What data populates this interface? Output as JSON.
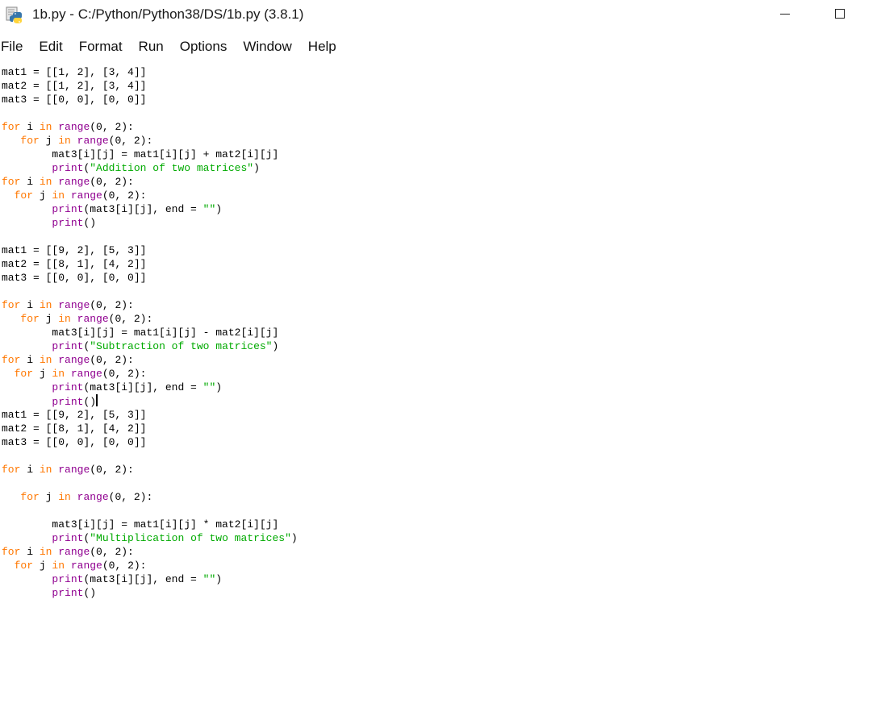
{
  "window": {
    "title": "1b.py - C:/Python/Python38/DS/1b.py (3.8.1)",
    "icon": "python-idle-icon",
    "controls": [
      "minimize-icon",
      "maximize-icon"
    ]
  },
  "menu": {
    "items": [
      "File",
      "Edit",
      "Format",
      "Run",
      "Options",
      "Window",
      "Help"
    ]
  },
  "colors": {
    "keyword": "#ff7700",
    "builtin": "#900090",
    "string": "#00aa00",
    "default": "#000000"
  },
  "editor": {
    "caret_line": 24,
    "lines": [
      [
        [
          "",
          "mat1 = [[1, 2], [3, 4]]"
        ]
      ],
      [
        [
          "",
          "mat2 = [[1, 2], [3, 4]]"
        ]
      ],
      [
        [
          "",
          "mat3 = [[0, 0], [0, 0]]"
        ]
      ],
      [],
      [
        [
          "kw",
          "for"
        ],
        [
          "",
          " i "
        ],
        [
          "kw",
          "in"
        ],
        [
          "",
          " "
        ],
        [
          "bi",
          "range"
        ],
        [
          "",
          "(0, 2):"
        ]
      ],
      [
        [
          "",
          "   "
        ],
        [
          "kw",
          "for"
        ],
        [
          "",
          " j "
        ],
        [
          "kw",
          "in"
        ],
        [
          "",
          " "
        ],
        [
          "bi",
          "range"
        ],
        [
          "",
          "(0, 2):"
        ]
      ],
      [
        [
          "",
          "        mat3[i][j] = mat1[i][j] + mat2[i][j]"
        ]
      ],
      [
        [
          "",
          "        "
        ],
        [
          "bi",
          "print"
        ],
        [
          "",
          "("
        ],
        [
          "str",
          "\"Addition of two matrices\""
        ],
        [
          "",
          ")"
        ]
      ],
      [
        [
          "kw",
          "for"
        ],
        [
          "",
          " i "
        ],
        [
          "kw",
          "in"
        ],
        [
          "",
          " "
        ],
        [
          "bi",
          "range"
        ],
        [
          "",
          "(0, 2):"
        ]
      ],
      [
        [
          "",
          "  "
        ],
        [
          "kw",
          "for"
        ],
        [
          "",
          " j "
        ],
        [
          "kw",
          "in"
        ],
        [
          "",
          " "
        ],
        [
          "bi",
          "range"
        ],
        [
          "",
          "(0, 2):"
        ]
      ],
      [
        [
          "",
          "        "
        ],
        [
          "bi",
          "print"
        ],
        [
          "",
          "(mat3[i][j], end = "
        ],
        [
          "str",
          "\"\""
        ],
        [
          "",
          ")"
        ]
      ],
      [
        [
          "",
          "        "
        ],
        [
          "bi",
          "print"
        ],
        [
          "",
          "()"
        ]
      ],
      [],
      [
        [
          "",
          "mat1 = [[9, 2], [5, 3]]"
        ]
      ],
      [
        [
          "",
          "mat2 = [[8, 1], [4, 2]]"
        ]
      ],
      [
        [
          "",
          "mat3 = [[0, 0], [0, 0]]"
        ]
      ],
      [],
      [
        [
          "kw",
          "for"
        ],
        [
          "",
          " i "
        ],
        [
          "kw",
          "in"
        ],
        [
          "",
          " "
        ],
        [
          "bi",
          "range"
        ],
        [
          "",
          "(0, 2):"
        ]
      ],
      [
        [
          "",
          "   "
        ],
        [
          "kw",
          "for"
        ],
        [
          "",
          " j "
        ],
        [
          "kw",
          "in"
        ],
        [
          "",
          " "
        ],
        [
          "bi",
          "range"
        ],
        [
          "",
          "(0, 2):"
        ]
      ],
      [
        [
          "",
          "        mat3[i][j] = mat1[i][j] - mat2[i][j]"
        ]
      ],
      [
        [
          "",
          "        "
        ],
        [
          "bi",
          "print"
        ],
        [
          "",
          "("
        ],
        [
          "str",
          "\"Subtraction of two matrices\""
        ],
        [
          "",
          ")"
        ]
      ],
      [
        [
          "kw",
          "for"
        ],
        [
          "",
          " i "
        ],
        [
          "kw",
          "in"
        ],
        [
          "",
          " "
        ],
        [
          "bi",
          "range"
        ],
        [
          "",
          "(0, 2):"
        ]
      ],
      [
        [
          "",
          "  "
        ],
        [
          "kw",
          "for"
        ],
        [
          "",
          " j "
        ],
        [
          "kw",
          "in"
        ],
        [
          "",
          " "
        ],
        [
          "bi",
          "range"
        ],
        [
          "",
          "(0, 2):"
        ]
      ],
      [
        [
          "",
          "        "
        ],
        [
          "bi",
          "print"
        ],
        [
          "",
          "(mat3[i][j], end = "
        ],
        [
          "str",
          "\"\""
        ],
        [
          "",
          ")"
        ]
      ],
      [
        [
          "",
          "        "
        ],
        [
          "bi",
          "print"
        ],
        [
          "",
          "()"
        ]
      ],
      [
        [
          "",
          "mat1 = [[9, 2], [5, 3]]"
        ]
      ],
      [
        [
          "",
          "mat2 = [[8, 1], [4, 2]]"
        ]
      ],
      [
        [
          "",
          "mat3 = [[0, 0], [0, 0]]"
        ]
      ],
      [],
      [
        [
          "kw",
          "for"
        ],
        [
          "",
          " i "
        ],
        [
          "kw",
          "in"
        ],
        [
          "",
          " "
        ],
        [
          "bi",
          "range"
        ],
        [
          "",
          "(0, 2):"
        ]
      ],
      [],
      [
        [
          "",
          "   "
        ],
        [
          "kw",
          "for"
        ],
        [
          "",
          " j "
        ],
        [
          "kw",
          "in"
        ],
        [
          "",
          " "
        ],
        [
          "bi",
          "range"
        ],
        [
          "",
          "(0, 2):"
        ]
      ],
      [],
      [
        [
          "",
          "        mat3[i][j] = mat1[i][j] * mat2[i][j]"
        ]
      ],
      [
        [
          "",
          "        "
        ],
        [
          "bi",
          "print"
        ],
        [
          "",
          "("
        ],
        [
          "str",
          "\"Multiplication of two matrices\""
        ],
        [
          "",
          ")"
        ]
      ],
      [
        [
          "kw",
          "for"
        ],
        [
          "",
          " i "
        ],
        [
          "kw",
          "in"
        ],
        [
          "",
          " "
        ],
        [
          "bi",
          "range"
        ],
        [
          "",
          "(0, 2):"
        ]
      ],
      [
        [
          "",
          "  "
        ],
        [
          "kw",
          "for"
        ],
        [
          "",
          " j "
        ],
        [
          "kw",
          "in"
        ],
        [
          "",
          " "
        ],
        [
          "bi",
          "range"
        ],
        [
          "",
          "(0, 2):"
        ]
      ],
      [
        [
          "",
          "        "
        ],
        [
          "bi",
          "print"
        ],
        [
          "",
          "(mat3[i][j], end = "
        ],
        [
          "str",
          "\"\""
        ],
        [
          "",
          ")"
        ]
      ],
      [
        [
          "",
          "        "
        ],
        [
          "bi",
          "print"
        ],
        [
          "",
          "()"
        ]
      ]
    ]
  }
}
